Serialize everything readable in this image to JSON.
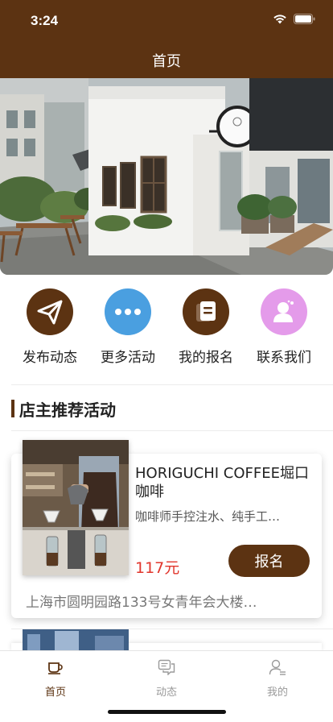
{
  "status_bar": {
    "time": "3:24"
  },
  "nav": {
    "title": "首页"
  },
  "quick_menu": [
    {
      "label": "发布动态",
      "icon": "paper-plane-icon",
      "color": "#5c3312"
    },
    {
      "label": "更多活动",
      "icon": "more-dots-icon",
      "color": "#4a9fe0"
    },
    {
      "label": "我的报名",
      "icon": "document-icon",
      "color": "#5c3312"
    },
    {
      "label": "联系我们",
      "icon": "person-icon",
      "color": "#e49bea"
    }
  ],
  "section": {
    "title": "店主推荐活动"
  },
  "activities": [
    {
      "title": "HORIGUCHI COFFEE堀口咖啡",
      "description": "咖啡师手控注水、纯手工…",
      "price": "117元",
      "signup_label": "报名",
      "address": "上海市圆明园路133号女青年会大楼…"
    }
  ],
  "tabs": [
    {
      "label": "首页",
      "icon": "coffee-cup-icon",
      "active": true
    },
    {
      "label": "动态",
      "icon": "chat-bubbles-icon",
      "active": false
    },
    {
      "label": "我的",
      "icon": "user-icon",
      "active": false
    }
  ],
  "colors": {
    "brand": "#5c3312",
    "price": "#e1362c",
    "tab_active": "#5c3312",
    "tab_inactive": "#9a9a9a"
  }
}
